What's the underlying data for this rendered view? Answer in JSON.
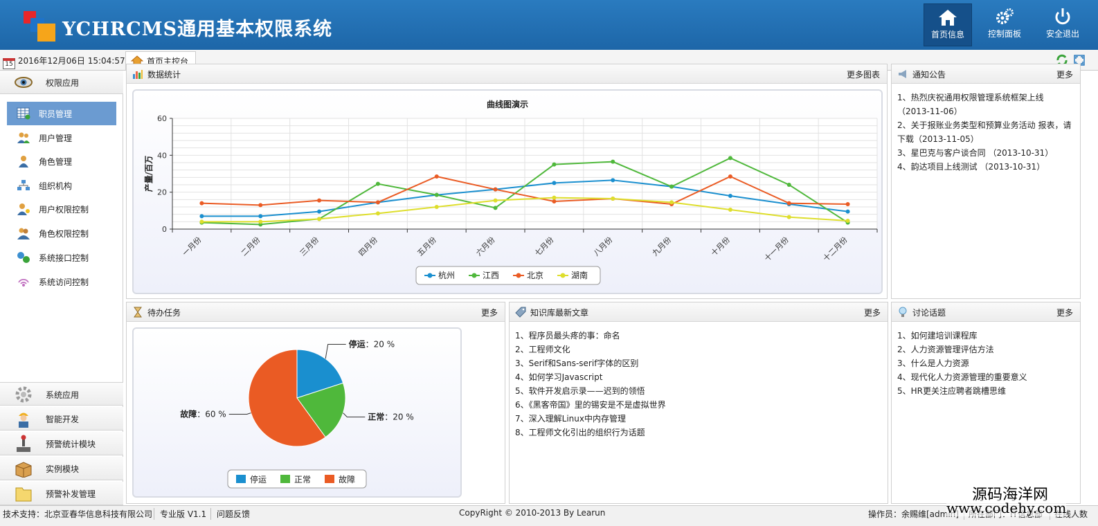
{
  "header": {
    "title": "YCHRCMS通用基本权限系统",
    "buttons": [
      {
        "label": "首页信息",
        "icon": "home-icon"
      },
      {
        "label": "控制面板",
        "icon": "gears-icon"
      },
      {
        "label": "安全退出",
        "icon": "power-icon"
      }
    ]
  },
  "toolbar": {
    "date": "2016年12月06日 15:04:57",
    "tab": "首页主控台"
  },
  "sidebar": {
    "groups": [
      {
        "label": "权限应用",
        "icon": "eye-icon"
      },
      {
        "label": "系统应用",
        "icon": "gear-icon"
      },
      {
        "label": "智能开发",
        "icon": "worker-icon"
      },
      {
        "label": "预警统计模块",
        "icon": "joystick-icon"
      },
      {
        "label": "实例模块",
        "icon": "box-icon"
      },
      {
        "label": "预警补发管理",
        "icon": "folder-icon"
      }
    ],
    "items": [
      {
        "label": "职员管理",
        "icon": "table-icon"
      },
      {
        "label": "用户管理",
        "icon": "users-icon"
      },
      {
        "label": "角色管理",
        "icon": "role-icon"
      },
      {
        "label": "组织机构",
        "icon": "org-icon"
      },
      {
        "label": "用户权限控制",
        "icon": "user-key-icon"
      },
      {
        "label": "角色权限控制",
        "icon": "roles-key-icon"
      },
      {
        "label": "系统接口控制",
        "icon": "interface-icon"
      },
      {
        "label": "系统访问控制",
        "icon": "signal-icon"
      }
    ]
  },
  "panels": {
    "stats": {
      "title": "数据统计",
      "more": "更多图表"
    },
    "notice": {
      "title": "通知公告",
      "more": "更多",
      "items": [
        "1、热烈庆祝通用权限管理系统框架上线 （2013-11-06）",
        "2、关于报账业务类型和预算业务活动 报表，请下载（2013-11-05）",
        "3、星巴克与客户谈合同 （2013-10-31）",
        "4、韵达项目上线测试 （2013-10-31）"
      ]
    },
    "todo": {
      "title": "待办任务",
      "more": "更多"
    },
    "kb": {
      "title": "知识库最新文章",
      "more": "更多",
      "items": [
        "1、程序员最头疼的事：命名",
        "2、工程师文化",
        "3、Serif和Sans-serif字体的区别",
        "4、如何学习Javascript",
        "5、软件开发启示录——迟到的领悟",
        "6、《黑客帝国》里的锡安是不是虚拟世界",
        "7、深入理解Linux中内存管理",
        "8、工程师文化引出的组织行为话题"
      ]
    },
    "talk": {
      "title": "讨论话题",
      "more": "更多",
      "items": [
        "1、如何建培训课程库",
        "2、人力资源管理评估方法",
        "3、什么是人力资源",
        "4、现代化人力资源管理的重要意义",
        "5、HR更关注应聘者跳槽思维"
      ]
    }
  },
  "chart_data": [
    {
      "type": "line",
      "title": "曲线图演示",
      "ylabel": "产量/百万",
      "ylim": [
        0,
        60
      ],
      "yticks": [
        "0",
        "20",
        "40",
        "60"
      ],
      "legend_position": "bottom",
      "grid": true,
      "categories": [
        "一月份",
        "二月份",
        "三月份",
        "四月份",
        "五月份",
        "六月份",
        "七月份",
        "八月份",
        "九月份",
        "十月份",
        "十一月份",
        "十二月份"
      ],
      "series": [
        {
          "name": "杭州",
          "color": "#1a8fcf",
          "values": [
            7,
            7,
            9.5,
            14.5,
            18.5,
            21.5,
            25,
            26.5,
            23,
            18,
            13.5,
            9.5
          ]
        },
        {
          "name": "江西",
          "color": "#4fb83b",
          "values": [
            3.5,
            2.5,
            5.5,
            24.5,
            18.5,
            11.5,
            35,
            36.5,
            23,
            38.5,
            24,
            3.5
          ]
        },
        {
          "name": "北京",
          "color": "#ea5b24",
          "values": [
            14,
            13,
            15.5,
            14.5,
            28.5,
            21.5,
            15,
            16.5,
            13.5,
            28.5,
            14,
            13.5
          ]
        },
        {
          "name": "湖南",
          "color": "#dede2c",
          "values": [
            4,
            4,
            5.5,
            8.5,
            12,
            15.5,
            17,
            16.5,
            14.5,
            10.5,
            6.5,
            4.5
          ]
        }
      ]
    },
    {
      "type": "pie",
      "slices": [
        {
          "name": "停运",
          "value": 20,
          "label": "20 %",
          "color": "#1a8fcf"
        },
        {
          "name": "正常",
          "value": 20,
          "label": "20 %",
          "color": "#4fb83b"
        },
        {
          "name": "故障",
          "value": 60,
          "label": "60 %",
          "color": "#ea5b24"
        }
      ]
    }
  ],
  "footer": {
    "support": "技术支持：北京亚春华信息科技有限公司",
    "version": "专业版 V1.1",
    "feedback": "问题反馈",
    "copyright": "CopyRight © 2010-2013 By Learun",
    "operator": "操作员：余赐维[admin]",
    "dept": "所在部门：IT信息部",
    "extra": "在线人数"
  },
  "watermark": {
    "line1": "源码海洋网",
    "line2": "www.codehy.com"
  }
}
